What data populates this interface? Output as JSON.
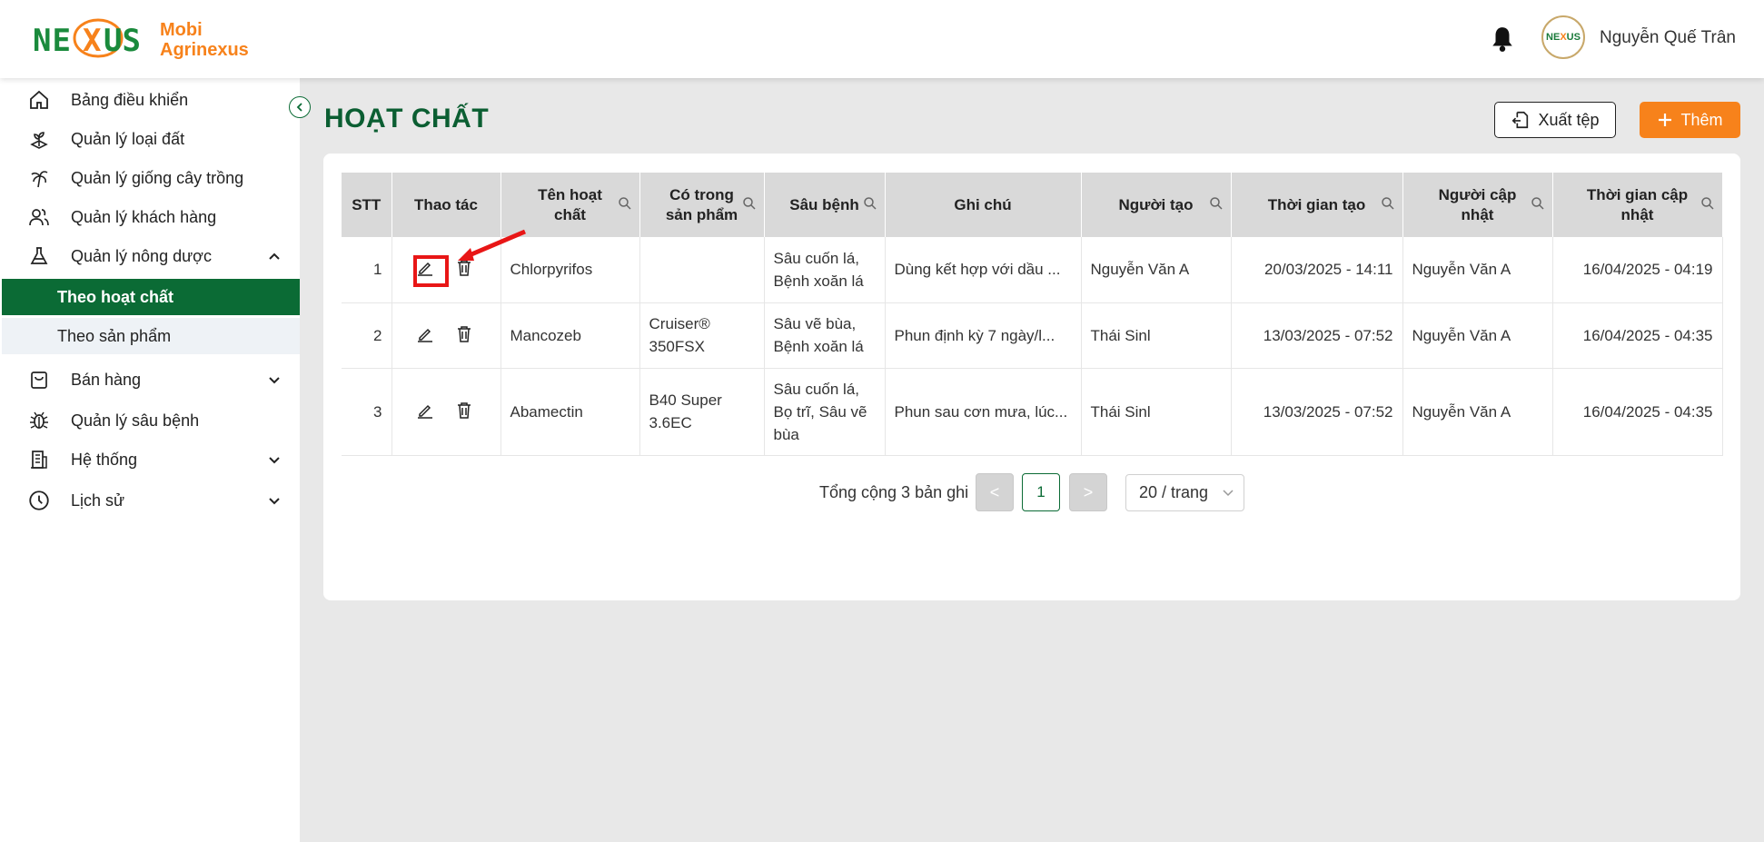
{
  "header": {
    "logo_mark": "NEXUS",
    "logo_line1": "Mobi",
    "logo_line2": "Agrinexus",
    "user_name": "Nguyễn Quế Trân",
    "avatar_text_a": "NE",
    "avatar_text_b": "X",
    "avatar_text_c": "US"
  },
  "sidebar": {
    "items": [
      {
        "label": "Bảng điều khiển",
        "icon": "home-icon"
      },
      {
        "label": "Quản lý loại đất",
        "icon": "soil-icon"
      },
      {
        "label": "Quản lý giống cây trồng",
        "icon": "palm-tree-icon"
      },
      {
        "label": "Quản lý khách hàng",
        "icon": "users-icon"
      },
      {
        "label": "Quản lý nông dược",
        "icon": "flask-icon",
        "expanded": true
      },
      {
        "label": "Bán hàng",
        "icon": "shopping-bag-icon"
      },
      {
        "label": "Quản lý sâu bệnh",
        "icon": "bug-icon"
      },
      {
        "label": "Hệ thống",
        "icon": "building-icon"
      },
      {
        "label": "Lịch sử",
        "icon": "clock-icon"
      }
    ],
    "sub_items": [
      {
        "label": "Theo hoạt chất",
        "active": true
      },
      {
        "label": "Theo sản phẩm",
        "active": false
      }
    ]
  },
  "page": {
    "title": "HOẠT CHẤT",
    "export_label": "Xuất tệp",
    "add_label": "Thêm"
  },
  "table": {
    "headers": [
      {
        "l1": "STT",
        "l2": ""
      },
      {
        "l1": "Thao tác",
        "l2": ""
      },
      {
        "l1": "Tên hoạt",
        "l2": "chất"
      },
      {
        "l1": "Có trong",
        "l2": "sản phẩm"
      },
      {
        "l1": "Sâu bệnh",
        "l2": ""
      },
      {
        "l1": "Ghi chú",
        "l2": ""
      },
      {
        "l1": "Người tạo",
        "l2": ""
      },
      {
        "l1": "Thời gian tạo",
        "l2": ""
      },
      {
        "l1": "Người cập",
        "l2": "nhật"
      },
      {
        "l1": "Thời gian cập",
        "l2": "nhật"
      }
    ],
    "rows": [
      {
        "stt": "1",
        "name": "Chlorpyrifos",
        "product_l1": "",
        "product_l2": "",
        "pest_l1": "Sâu cuốn lá,",
        "pest_l2": "Bệnh xoăn lá",
        "pest_l3": "",
        "note": "Dùng kết hợp với dầu ...",
        "creator": "Nguyễn Văn A",
        "created": "20/03/2025 - 14:11",
        "updater": "Nguyễn Văn A",
        "updated": "16/04/2025 - 04:19"
      },
      {
        "stt": "2",
        "name": "Mancozeb",
        "product_l1": "Cruiser®",
        "product_l2": "350FSX",
        "pest_l1": "Sâu vẽ bùa,",
        "pest_l2": "Bệnh xoăn lá",
        "pest_l3": "",
        "note": "Phun định kỳ 7 ngày/l...",
        "creator": "Thái Sinl",
        "created": "13/03/2025 - 07:52",
        "updater": "Nguyễn Văn A",
        "updated": "16/04/2025 - 04:35"
      },
      {
        "stt": "3",
        "name": "Abamectin",
        "product_l1": "B40 Super",
        "product_l2": "3.6EC",
        "pest_l1": "Sâu cuốn lá,",
        "pest_l2": "Bọ trĩ, Sâu vẽ",
        "pest_l3": "bùa",
        "note": "Phun sau cơn mưa, lúc...",
        "creator": "Thái Sinl",
        "created": "13/03/2025 - 07:52",
        "updater": "Nguyễn Văn A",
        "updated": "16/04/2025 - 04:35"
      }
    ]
  },
  "pagination": {
    "total_label": "Tổng cộng 3 bản ghi",
    "prev": "<",
    "next": ">",
    "current_page": "1",
    "page_size": "20 / trang"
  },
  "colors": {
    "primary_green": "#0b6b35",
    "accent_orange": "#f7821b",
    "highlight_red": "#e81616"
  }
}
